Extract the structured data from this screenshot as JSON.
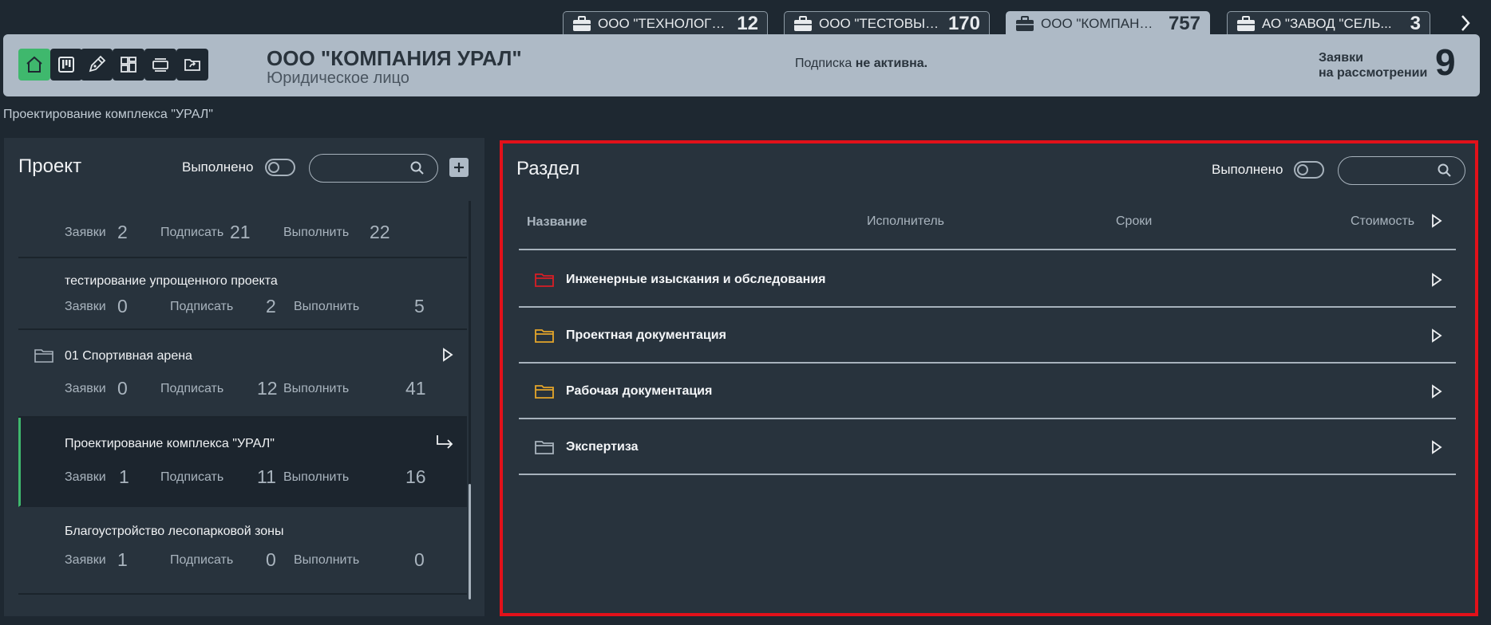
{
  "tabs": [
    {
      "name": "ООО \"ТЕХНОЛОГИЯ...",
      "count": "12"
    },
    {
      "name": "ООО \"ТЕСТОВЫЕ Р...",
      "count": "170"
    },
    {
      "name": "ООО \"КОМПАНИЯ У...",
      "count": "757"
    },
    {
      "name": "АО \"ЗАВОД \"СЕЛЬ...",
      "count": "3"
    }
  ],
  "header": {
    "title": "ООО \"КОМПАНИЯ УРАЛ\"",
    "subtitle": "Юридическое лицо",
    "subscription_prefix": "Подписка",
    "subscription_status": "не активна.",
    "requests_label_1": "Заявки",
    "requests_label_2": "на рассмотрении",
    "requests_count": "9",
    "buttons": [
      "home-icon",
      "kanban-icon",
      "pen-icon",
      "dashboard-icon",
      "layers-icon",
      "folder-share-icon"
    ]
  },
  "breadcrumb": "Проектирование комплекса \"УРАЛ\"",
  "project_panel": {
    "title": "Проект",
    "done_label": "Выполнено",
    "search_placeholder": "",
    "stat_labels": {
      "requests": "Заявки",
      "sign": "Подписать",
      "execute": "Выполнить"
    },
    "items": [
      {
        "name": "",
        "requests": "2",
        "sign": "21",
        "execute": "22",
        "icon": "folder-icon"
      },
      {
        "name": "тестирование упрощенного проекта",
        "requests": "0",
        "sign": "2",
        "execute": "5"
      },
      {
        "name": "01 Спортивная арена",
        "requests": "0",
        "sign": "12",
        "execute": "41",
        "icon": "folder-icon",
        "action": "play-arrow-icon"
      },
      {
        "name": "Проектирование комплекса \"УРАЛ\"",
        "requests": "1",
        "sign": "11",
        "execute": "16",
        "action": "return-arrow-icon",
        "selected": true
      },
      {
        "name": "Благоустройство лесопарковой зоны",
        "requests": "1",
        "sign": "0",
        "execute": "0"
      }
    ]
  },
  "section_panel": {
    "title": "Раздел",
    "done_label": "Выполнено",
    "search_placeholder": "",
    "columns": {
      "name": "Название",
      "executor": "Исполнитель",
      "deadline": "Сроки",
      "cost": "Стоимость"
    },
    "rows": [
      {
        "name": "Инженерные изыскания и обследования",
        "folder_color": "#d91e25"
      },
      {
        "name": "Проектная документация",
        "folder_color": "#e4a52a"
      },
      {
        "name": "Рабочая документация",
        "folder_color": "#e4a52a"
      },
      {
        "name": "Экспертиза",
        "folder_color": "#a7b2bc"
      }
    ]
  },
  "colors": {
    "accent": "#3fb86d",
    "highlight_border": "#e2111a",
    "header_bg": "#aebac6"
  }
}
